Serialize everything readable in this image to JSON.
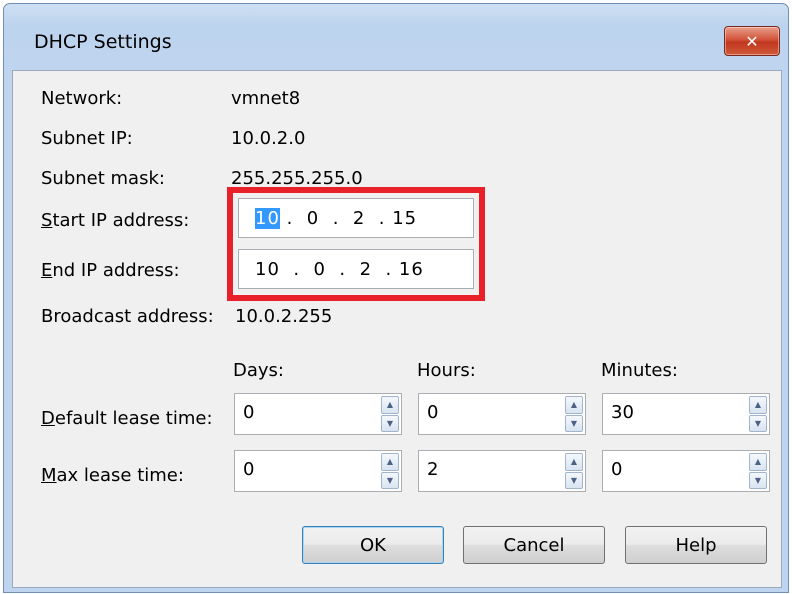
{
  "dialog": {
    "title": "DHCP Settings",
    "close_label": "✕"
  },
  "info": {
    "network_label": "Network:",
    "network_value": "vmnet8",
    "subnet_ip_label": "Subnet IP:",
    "subnet_ip_value": "10.0.2.0",
    "subnet_mask_label": "Subnet mask:",
    "subnet_mask_value": "255.255.255.0",
    "start_ip_label_first": "S",
    "start_ip_label_rest": "tart IP address:",
    "start_ip_selected": "10",
    "start_ip_rest": " .  0  .  2  . 15",
    "end_ip_label_first": "E",
    "end_ip_label_rest": "nd IP address:",
    "end_ip_value": "10  .  0  .  2  . 16",
    "broadcast_label": "Broadcast address:",
    "broadcast_value": "10.0.2.255"
  },
  "lease": {
    "col_days": "Days:",
    "col_hours": "Hours:",
    "col_minutes": "Minutes:",
    "default_label_first": "D",
    "default_label_rest": "efault lease time:",
    "max_label_first": "M",
    "max_label_rest": "ax lease time:",
    "default_days": "0",
    "default_hours": "0",
    "default_minutes": "30",
    "max_days": "0",
    "max_hours": "2",
    "max_minutes": "0"
  },
  "buttons": {
    "ok": "OK",
    "cancel": "Cancel",
    "help": "Help"
  },
  "icons": {
    "spin_up": "▲",
    "spin_down": "▼"
  },
  "colors": {
    "highlight": "#e8202a",
    "selection": "#3399ff"
  }
}
